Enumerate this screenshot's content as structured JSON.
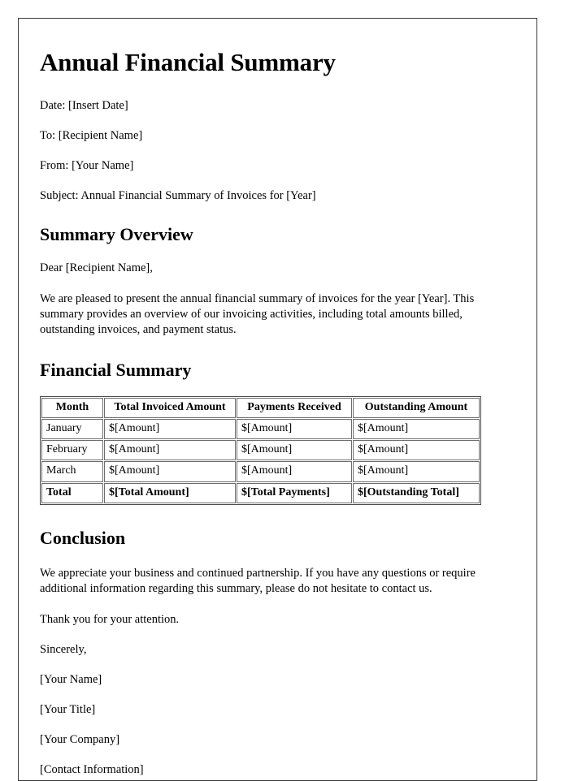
{
  "document": {
    "title": "Annual Financial Summary",
    "meta": [
      "Date: [Insert Date]",
      "To: [Recipient Name]",
      "From: [Your Name]",
      "Subject: Annual Financial Summary of Invoices for [Year]"
    ],
    "summary_overview": {
      "heading": "Summary Overview",
      "salutation": "Dear [Recipient Name],",
      "paragraph": "We are pleased to present the annual financial summary of invoices for the year [Year]. This summary provides an overview of our invoicing activities, including total amounts billed, outstanding invoices, and payment status."
    },
    "financial_summary": {
      "heading": "Financial Summary",
      "table": {
        "columns": [
          "Month",
          "Total Invoiced Amount",
          "Payments Received",
          "Outstanding Amount"
        ],
        "rows": [
          [
            "January",
            "$[Amount]",
            "$[Amount]",
            "$[Amount]"
          ],
          [
            "February",
            "$[Amount]",
            "$[Amount]",
            "$[Amount]"
          ],
          [
            "March",
            "$[Amount]",
            "$[Amount]",
            "$[Amount]"
          ]
        ],
        "total_row": [
          "Total",
          "$[Total Amount]",
          "$[Total Payments]",
          "$[Outstanding Total]"
        ]
      }
    },
    "conclusion": {
      "heading": "Conclusion",
      "paragraph": "We appreciate your business and continued partnership. If you have any questions or require additional information regarding this summary, please do not hesitate to contact us.",
      "thanks": "Thank you for your attention."
    },
    "signature": [
      "Sincerely,",
      "[Your Name]",
      "[Your Title]",
      "[Your Company]",
      "[Contact Information]"
    ]
  }
}
